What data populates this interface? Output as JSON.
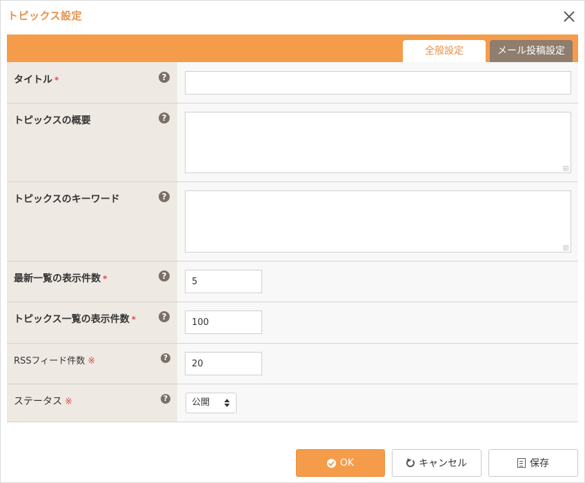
{
  "dialog": {
    "title": "トピックス設定",
    "close_icon": "close-icon"
  },
  "tabs": {
    "general": "全般設定",
    "mail": "メール投稿設定",
    "active": "mail"
  },
  "fields": {
    "title": {
      "label": "タイトル",
      "required": "*",
      "value": ""
    },
    "summary": {
      "label": "トピックスの概要",
      "value": ""
    },
    "keywords": {
      "label": "トピックスのキーワード",
      "value": ""
    },
    "latest_count": {
      "label": "最新一覧の表示件数",
      "required": "*",
      "value": "5"
    },
    "list_count": {
      "label": "トピックス一覧の表示件数",
      "required": "*",
      "value": "100"
    },
    "rss_count": {
      "label": "RSSフィード件数",
      "required_note": "※",
      "value": "20"
    },
    "status": {
      "label": "ステータス",
      "required_note": "※",
      "selected": "公開"
    }
  },
  "help_icon": {
    "glyph": "?"
  },
  "buttons": {
    "ok": "OK",
    "cancel": "キャンセル",
    "save": "保存"
  },
  "colors": {
    "accent": "#f59c4a",
    "tab_inactive": "#8f7d6e",
    "title": "#e8914a",
    "required": "#e04a4a"
  }
}
